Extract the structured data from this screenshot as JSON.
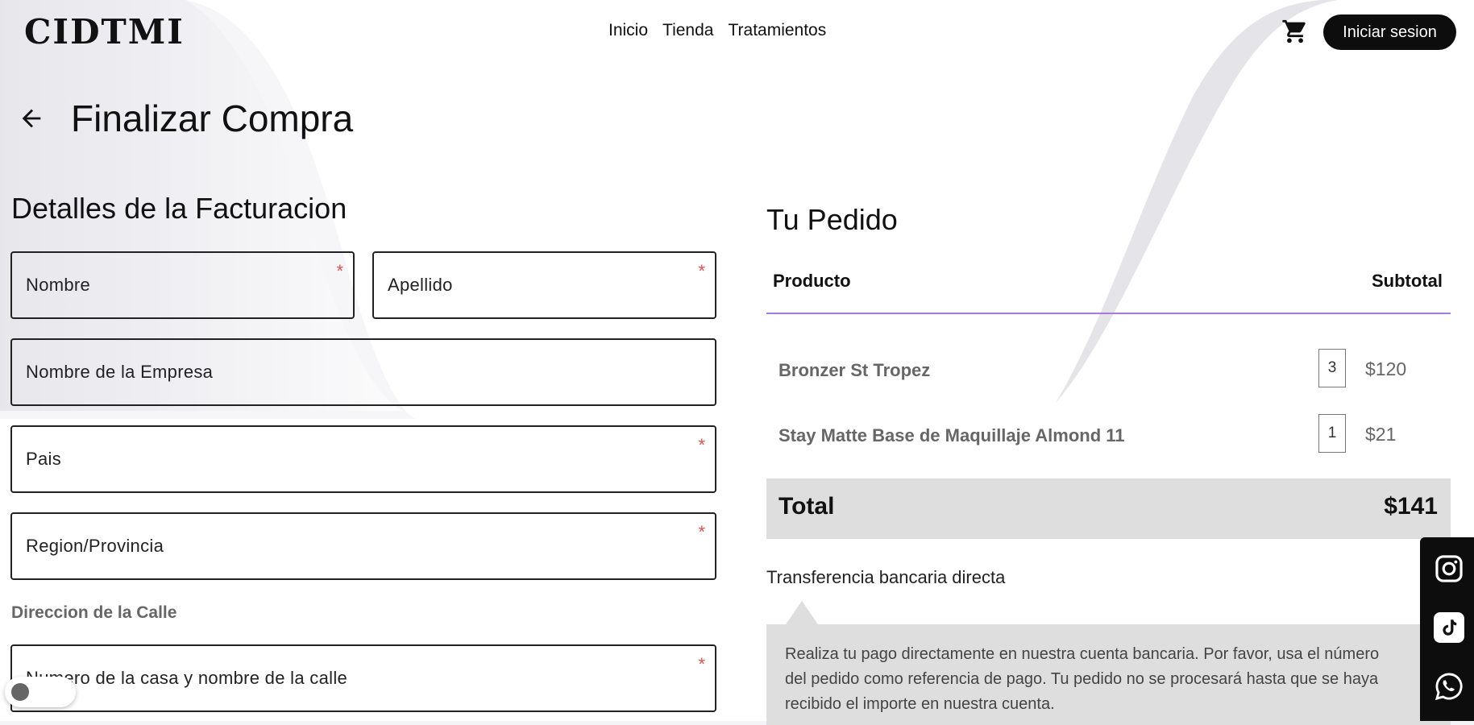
{
  "header": {
    "logo": "CIDTMI",
    "nav": [
      "Inicio",
      "Tienda",
      "Tratamientos"
    ],
    "cart_icon": "cart-icon",
    "login_label": "Iniciar sesion"
  },
  "page": {
    "back_icon": "arrow-left-icon",
    "title": "Finalizar Compra"
  },
  "billing": {
    "title": "Detalles de la Facturacion",
    "fields": {
      "first_name": "Nombre",
      "last_name": "Apellido",
      "company": "Nombre de la Empresa",
      "country": "Pais",
      "region": "Region/Provincia",
      "street_label": "Direccion de la Calle",
      "street": "Numero de la casa y nombre de la calle"
    },
    "required_mark": "*"
  },
  "order": {
    "title": "Tu Pedido",
    "col_product": "Producto",
    "col_subtotal": "Subtotal",
    "items": [
      {
        "name": "Bronzer St Tropez",
        "qty": "3",
        "price": "$120"
      },
      {
        "name": "Stay Matte Base de Maquillaje Almond 11",
        "qty": "1",
        "price": "$21"
      }
    ],
    "total_label": "Total",
    "total_value": "$141",
    "payment_method": "Transferencia bancaria directa",
    "payment_lines": [
      "Realiza tu pago directamente en nuestra cuenta bancaria. Por favor, usa el número",
      "del pedido como referencia de pago. Tu pedido no se procesará hasta que se haya",
      "recibido el importe en nuestra cuenta."
    ]
  },
  "social": [
    "instagram-icon",
    "tiktok-icon",
    "whatsapp-icon"
  ],
  "colors": {
    "accent_line": "#a27cd8",
    "required": "#d9534f",
    "dark": "#0d0d0d"
  }
}
